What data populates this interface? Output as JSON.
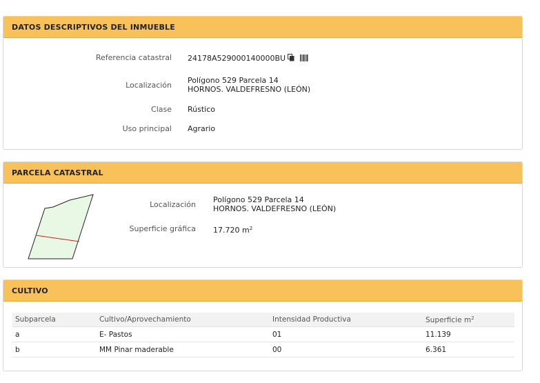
{
  "inmueble": {
    "title": "DATOS DESCRIPTIVOS DEL INMUEBLE",
    "ref_label": "Referencia catastral",
    "ref_value": "24178A529000140000BU",
    "loc_label": "Localización",
    "loc_line1": "Polígono 529 Parcela 14",
    "loc_line2": "HORNOS. VALDEFRESNO (LEÓN)",
    "clase_label": "Clase",
    "clase_value": "Rústico",
    "uso_label": "Uso principal",
    "uso_value": "Agrario"
  },
  "parcela": {
    "title": "PARCELA CATASTRAL",
    "loc_label": "Localización",
    "loc_line1": "Polígono 529 Parcela 14",
    "loc_line2": "HORNOS. VALDEFRESNO (LEÓN)",
    "sup_label": "Superficie gráfica",
    "sup_value": "17.720 m",
    "sup_unit_exp": "2"
  },
  "cultivo": {
    "title": "CULTIVO",
    "headers": {
      "subparcela": "Subparcela",
      "cultivo": "Cultivo/Aprovechamiento",
      "intensidad": "Intensidad Productiva",
      "superficie": "Superficie m",
      "superficie_exp": "2"
    },
    "rows": [
      {
        "subparcela": "a",
        "cultivo": "E- Pastos",
        "intensidad": "01",
        "superficie": "11.139"
      },
      {
        "subparcela": "b",
        "cultivo": "MM Pinar maderable",
        "intensidad": "00",
        "superficie": "6.361"
      }
    ]
  },
  "icons": {
    "copy": "copy-icon",
    "barcode": "barcode-icon"
  },
  "colors": {
    "header_bg": "#f8c15a",
    "parcel_fill": "#e8f8e4",
    "subparcel_line": "#cc2222"
  }
}
